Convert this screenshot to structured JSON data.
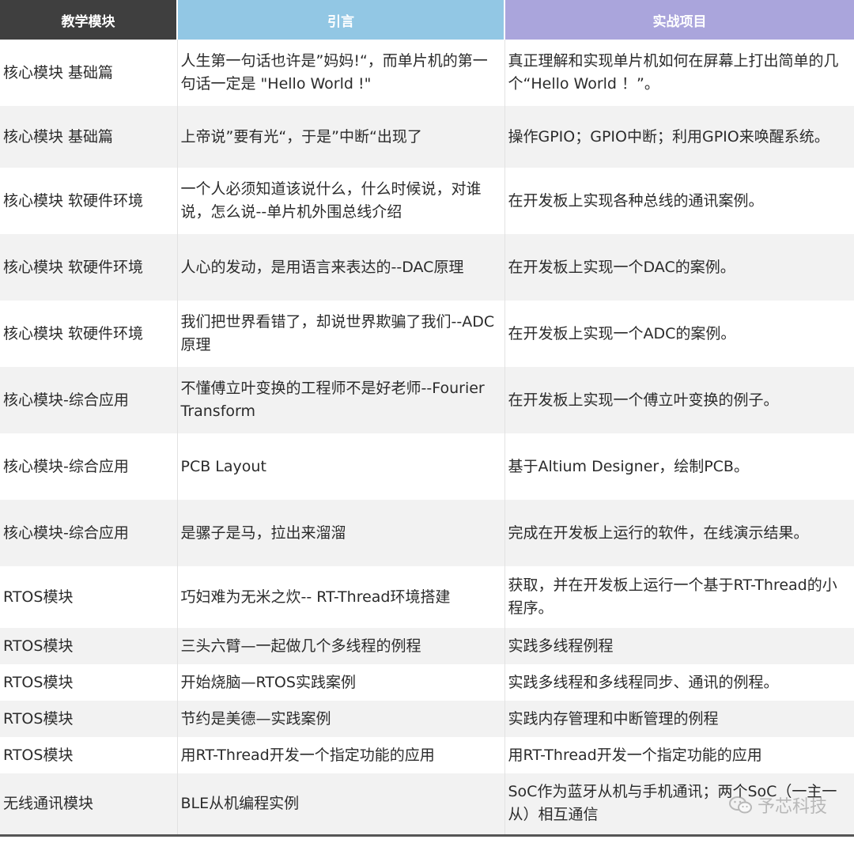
{
  "table": {
    "headers": [
      "教学模块",
      "引言",
      "实战项目"
    ],
    "rows": [
      [
        "核心模块 基础篇",
        "人生第一句话也许是”妈妈!“，而单片机的第一句话一定是 \"Hello World !\"",
        "真正理解和实现单片机如何在屏幕上打出简单的几个“Hello World ！”。"
      ],
      [
        "核心模块 基础篇",
        "上帝说”要有光“，于是”中断“出现了",
        "操作GPIO；GPIO中断；利用GPIO来唤醒系统。"
      ],
      [
        "核心模块 软硬件环境",
        "一个人必须知道该说什么，什么时候说，对谁说，怎么说--单片机外围总线介绍",
        "在开发板上实现各种总线的通讯案例。"
      ],
      [
        "核心模块 软硬件环境",
        "人心的发动，是用语言来表达的--DAC原理",
        "在开发板上实现一个DAC的案例。"
      ],
      [
        "核心模块 软硬件环境",
        "我们把世界看错了，却说世界欺骗了我们--ADC原理",
        "在开发板上实现一个ADC的案例。"
      ],
      [
        "核心模块-综合应用",
        "不懂傅立叶变换的工程师不是好老师--Fourier Transform",
        "在开发板上实现一个傅立叶变换的例子。"
      ],
      [
        "核心模块-综合应用",
        "PCB Layout",
        "基于Altium Designer，绘制PCB。"
      ],
      [
        "核心模块-综合应用",
        "是骡子是马，拉出来溜溜",
        "完成在开发板上运行的软件，在线演示结果。"
      ],
      [
        "RTOS模块",
        "巧妇难为无米之炊-- RT-Thread环境搭建",
        "获取，并在开发板上运行一个基于RT-Thread的小程序。"
      ],
      [
        "RTOS模块",
        "三头六臂—一起做几个多线程的例程",
        "实践多线程例程"
      ],
      [
        "RTOS模块",
        "开始烧脑—RTOS实践案例",
        "实践多线程和多线程同步、通讯的例程。"
      ],
      [
        "RTOS模块",
        "节约是美德—实践案例",
        "实践内存管理和中断管理的例程"
      ],
      [
        "RTOS模块",
        "用RT-Thread开发一个指定功能的应用",
        "用RT-Thread开发一个指定功能的应用"
      ],
      [
        "无线通讯模块",
        "BLE从机编程实例",
        "SoC作为蓝牙从机与手机通讯；两个SoC（一主一从）相互通信"
      ]
    ]
  },
  "watermark": {
    "text": "予芯科技",
    "icon": "wechat-icon"
  }
}
